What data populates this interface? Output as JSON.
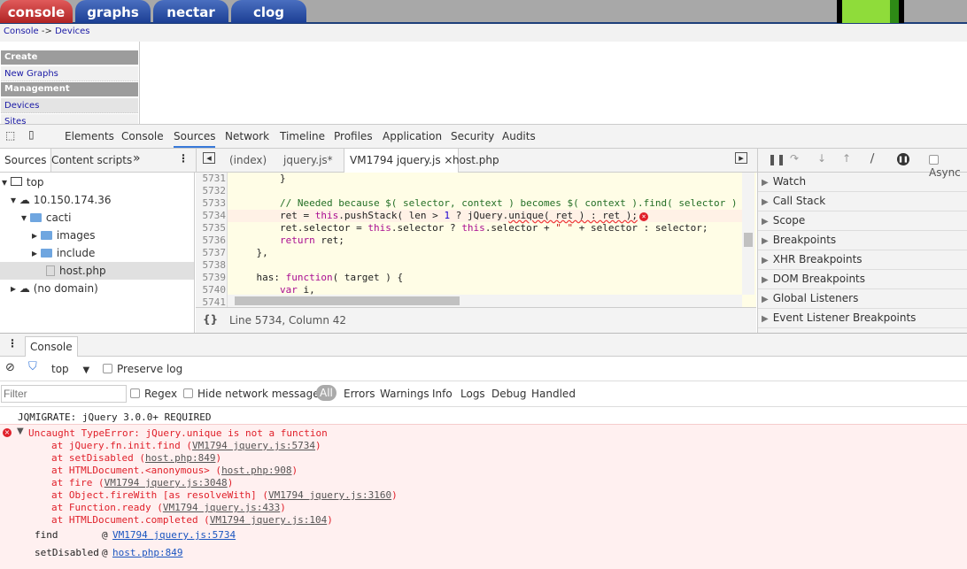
{
  "site": {
    "tabs": [
      "console",
      "graphs",
      "nectar",
      "clog"
    ],
    "active_tab": "console",
    "breadcrumb": {
      "root": "Console",
      "sep": "->",
      "current": "Devices"
    },
    "sidebar": [
      {
        "type": "header",
        "label": "Create"
      },
      {
        "type": "item",
        "label": "New Graphs"
      },
      {
        "type": "header",
        "label": "Management"
      },
      {
        "type": "item",
        "label": "Devices"
      },
      {
        "type": "item",
        "label": "Sites"
      }
    ]
  },
  "devtools": {
    "tabs": [
      "Elements",
      "Console",
      "Sources",
      "Network",
      "Timeline",
      "Profiles",
      "Application",
      "Security",
      "Audits"
    ],
    "active_tab": "Sources",
    "navigator_tabs": [
      "Sources",
      "Content scripts"
    ],
    "more": "»",
    "file_tabs": [
      "(index)",
      "jquery.js*",
      "VM1794 jquery.js",
      "host.php"
    ],
    "active_file": "VM1794 jquery.js",
    "tree": [
      {
        "label": "top",
        "icon": "frame-icon",
        "depth": 0
      },
      {
        "label": "10.150.174.36",
        "icon": "cloud-icon",
        "depth": 1
      },
      {
        "label": "cacti",
        "icon": "folder-icon",
        "depth": 2
      },
      {
        "label": "images",
        "icon": "folder-icon",
        "depth": 3
      },
      {
        "label": "include",
        "icon": "folder-icon",
        "depth": 3
      },
      {
        "label": "host.php",
        "icon": "file-icon",
        "depth": 3
      },
      {
        "label": "(no domain)",
        "icon": "cloud-icon",
        "depth": 1
      }
    ],
    "code": [
      {
        "n": "5731",
        "t": [
          [
            "",
            "        }"
          ]
        ]
      },
      {
        "n": "5732",
        "t": [
          [
            "",
            ""
          ]
        ]
      },
      {
        "n": "5733",
        "t": [
          [
            "cm",
            "        // Needed because $( selector, context ) becomes $( context ).find( selector )"
          ]
        ]
      },
      {
        "n": "5734",
        "t": [
          [
            "",
            "        ret = "
          ],
          [
            "kw",
            "this"
          ],
          [
            "",
            ".pushStack( len > "
          ],
          [
            "num",
            "1"
          ],
          [
            "",
            " ? jQuery."
          ],
          [
            "err",
            "unique( ret ) : ret );"
          ]
        ]
      },
      {
        "n": "5735",
        "t": [
          [
            "",
            "        ret.selector = "
          ],
          [
            "kw",
            "this"
          ],
          [
            "",
            ".selector ? "
          ],
          [
            "kw",
            "this"
          ],
          [
            "",
            ".selector + "
          ],
          [
            "str",
            "\" \""
          ],
          [
            "",
            " + selector : selector;"
          ]
        ]
      },
      {
        "n": "5736",
        "t": [
          [
            "kw",
            "        return"
          ],
          [
            "",
            " ret;"
          ]
        ]
      },
      {
        "n": "5737",
        "t": [
          [
            "",
            "    },"
          ]
        ]
      },
      {
        "n": "5738",
        "t": [
          [
            "",
            ""
          ]
        ]
      },
      {
        "n": "5739",
        "t": [
          [
            "",
            "    has: "
          ],
          [
            "kw",
            "function"
          ],
          [
            "",
            "( target ) {"
          ]
        ]
      },
      {
        "n": "5740",
        "t": [
          [
            "kw",
            "        var"
          ],
          [
            "",
            " i,"
          ]
        ]
      },
      {
        "n": "5741",
        "t": [
          [
            "",
            ""
          ]
        ]
      }
    ],
    "error_line": "5734",
    "status": "Line 5734, Column 42",
    "pretty_print": "{}",
    "debugger_sections": [
      "Watch",
      "Call Stack",
      "Scope",
      "Breakpoints",
      "XHR Breakpoints",
      "DOM Breakpoints",
      "Global Listeners",
      "Event Listener Breakpoints"
    ],
    "async_label": "Async"
  },
  "console": {
    "tab": "Console",
    "context": "top",
    "preserve_log": "Preserve log",
    "filter_placeholder": "Filter",
    "regex": "Regex",
    "hide_network": "Hide network messages",
    "levels": [
      "All",
      "Errors",
      "Warnings",
      "Info",
      "Logs",
      "Debug",
      "Handled"
    ],
    "active_level": "All",
    "messages": {
      "log": "JQMIGRATE: jQuery 3.0.0+ REQUIRED",
      "error": "Uncaught TypeError: jQuery.unique is not a function",
      "stack": [
        [
          "at jQuery.fn.init.find (",
          "VM1794 jquery.js:5734",
          ")"
        ],
        [
          "at setDisabled (",
          "host.php:849",
          ")"
        ],
        [
          "at HTMLDocument.<anonymous> (",
          "host.php:908",
          ")"
        ],
        [
          "at fire (",
          "VM1794 jquery.js:3048",
          ")"
        ],
        [
          "at Object.fireWith [as resolveWith] (",
          "VM1794 jquery.js:3160",
          ")"
        ],
        [
          "at Function.ready (",
          "VM1794 jquery.js:433",
          ")"
        ],
        [
          "at HTMLDocument.completed (",
          "VM1794 jquery.js:104",
          ")"
        ]
      ],
      "frames": [
        {
          "fn": "find",
          "at": "@",
          "loc": "VM1794 jquery.js:5734"
        },
        {
          "fn": "setDisabled",
          "at": "@",
          "loc": "host.php:849"
        }
      ]
    }
  },
  "colors": {
    "error": "#e0202a",
    "link": "#1a55c0",
    "active_tab": "#3879d9",
    "cacti_red": "#c23030",
    "cacti_blue": "#1c3f94"
  }
}
